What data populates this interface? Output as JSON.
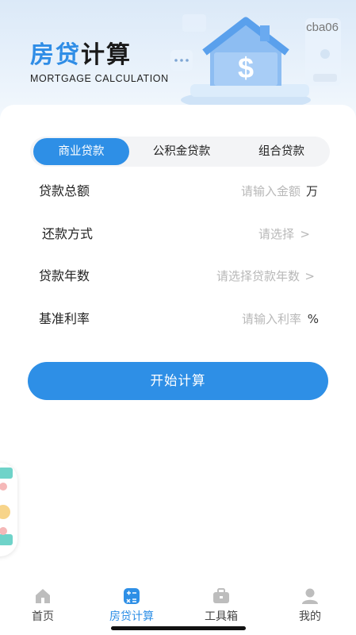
{
  "header": {
    "title_accent": "房贷",
    "title_rest": "计算",
    "subtitle": "MORTGAGE CALCULATION",
    "user_id": "cba06"
  },
  "tabs": [
    {
      "label": "商业贷款",
      "active": true
    },
    {
      "label": "公积金贷款",
      "active": false
    },
    {
      "label": "组合贷款",
      "active": false
    }
  ],
  "form": {
    "loan_amount": {
      "label": "贷款总额",
      "placeholder": "请输入金额",
      "unit": "万"
    },
    "repay_method": {
      "label": "还款方式",
      "placeholder": "请选择"
    },
    "loan_years": {
      "label": "贷款年数",
      "placeholder": "请选择贷款年数"
    },
    "base_rate": {
      "label": "基准利率",
      "placeholder": "请输入利率",
      "unit": "%"
    }
  },
  "calc_button": "开始计算",
  "nav": [
    {
      "label": "首页",
      "icon": "home-icon",
      "active": false
    },
    {
      "label": "房贷计算",
      "icon": "calculator-icon",
      "active": true
    },
    {
      "label": "工具箱",
      "icon": "toolbox-icon",
      "active": false
    },
    {
      "label": "我的",
      "icon": "user-icon",
      "active": false
    }
  ],
  "colors": {
    "accent": "#2e8fe6",
    "placeholder": "#b8b8b8"
  }
}
